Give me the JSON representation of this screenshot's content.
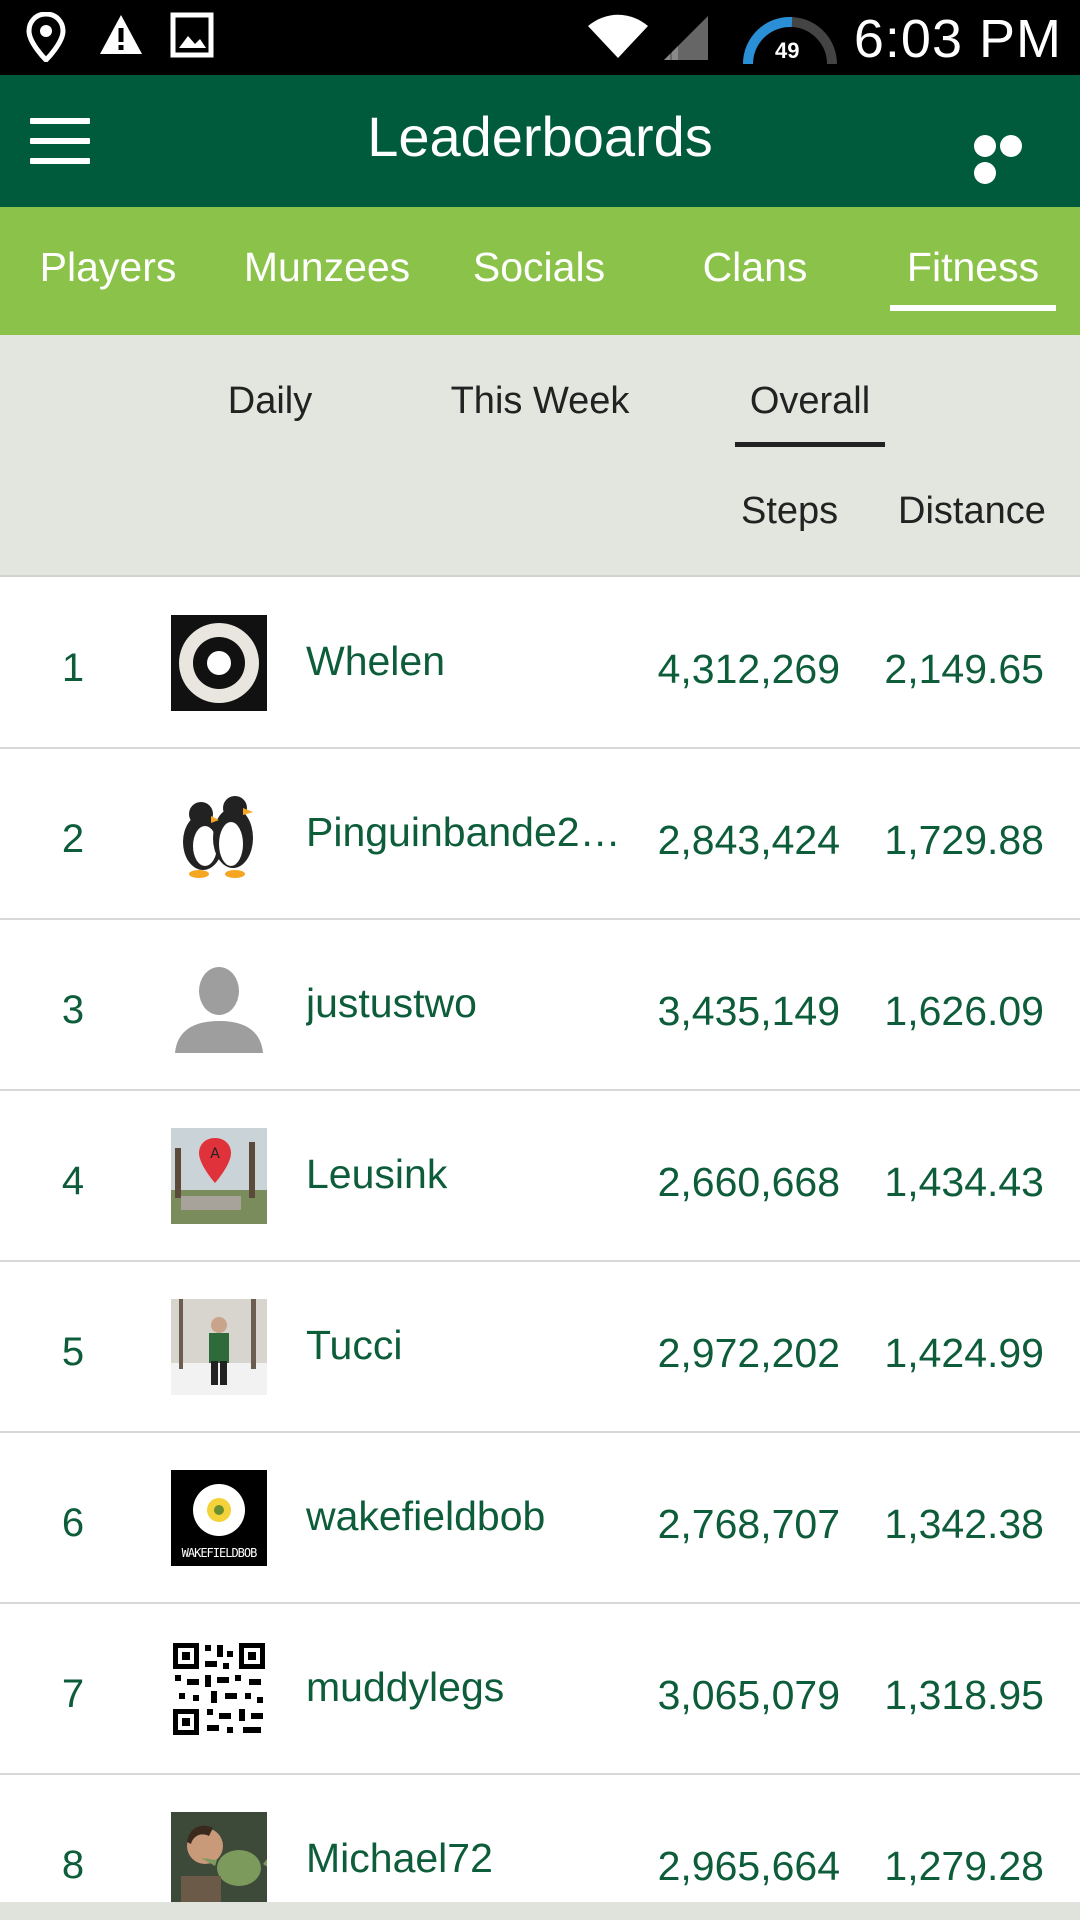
{
  "status_bar": {
    "time": "6:03 PM",
    "speed_value": "49",
    "icons": [
      "location-pin-icon",
      "warning-icon",
      "image-icon",
      "wifi-icon",
      "signal-icon",
      "speedometer-icon"
    ]
  },
  "app_bar": {
    "title": "Leaderboards",
    "menu_icon": "hamburger-menu-icon",
    "more_icon": "more-options-icon"
  },
  "category_tabs": [
    {
      "label": "Players",
      "active": false
    },
    {
      "label": "Munzees",
      "active": false
    },
    {
      "label": "Socials",
      "active": false
    },
    {
      "label": "Clans",
      "active": false
    },
    {
      "label": "Fitness",
      "active": true
    }
  ],
  "period_tabs": [
    {
      "label": "Daily",
      "active": false
    },
    {
      "label": "This Week",
      "active": false
    },
    {
      "label": "Overall",
      "active": true
    }
  ],
  "columns": {
    "steps": "Steps",
    "distance": "Distance"
  },
  "rows": [
    {
      "rank": "1",
      "name": "Whelen",
      "steps": "4,312,269",
      "distance": "2,149.65",
      "avatar": "target-avatar"
    },
    {
      "rank": "2",
      "name": "Pinguinbande20…",
      "steps": "2,843,424",
      "distance": "1,729.88",
      "avatar": "penguins-avatar"
    },
    {
      "rank": "3",
      "name": "justustwo",
      "steps": "3,435,149",
      "distance": "1,626.09",
      "avatar": "default-person-avatar"
    },
    {
      "rank": "4",
      "name": "Leusink",
      "steps": "2,660,668",
      "distance": "1,434.43",
      "avatar": "map-pin-photo-avatar"
    },
    {
      "rank": "5",
      "name": "Tucci",
      "steps": "2,972,202",
      "distance": "1,424.99",
      "avatar": "snow-person-photo-avatar"
    },
    {
      "rank": "6",
      "name": "wakefieldbob",
      "steps": "2,768,707",
      "distance": "1,342.38",
      "avatar": "rose-logo-avatar",
      "avatar_text": "WAKEFIELDBOB"
    },
    {
      "rank": "7",
      "name": "muddylegs",
      "steps": "3,065,079",
      "distance": "1,318.95",
      "avatar": "qr-code-avatar"
    },
    {
      "rank": "8",
      "name": "Michael72",
      "steps": "2,965,664",
      "distance": "1,279.28",
      "avatar": "yoda-photo-avatar"
    }
  ],
  "colors": {
    "app_bar": "#005a3c",
    "tabs": "#8bc34a",
    "text_green": "#0d5c3a",
    "period_bg": "#e3e6df"
  }
}
